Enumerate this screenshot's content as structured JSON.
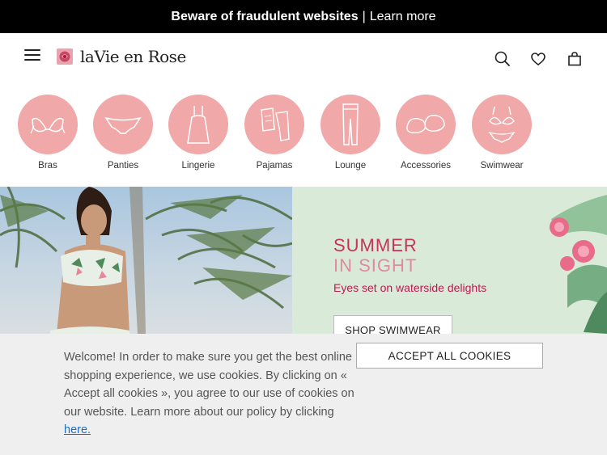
{
  "announcement": {
    "title": "Beware of fraudulent websites",
    "separator": "|",
    "link": "Learn more"
  },
  "header": {
    "logo_text": "laVie en Rose",
    "menu_icon": "hamburger-icon",
    "icons": [
      "search-icon",
      "heart-icon",
      "shopping-bag-icon"
    ]
  },
  "categories": [
    {
      "label": "Bras",
      "icon": "bra-icon"
    },
    {
      "label": "Panties",
      "icon": "panties-icon"
    },
    {
      "label": "Lingerie",
      "icon": "lingerie-icon"
    },
    {
      "label": "Pajamas",
      "icon": "pajamas-icon"
    },
    {
      "label": "Lounge",
      "icon": "lounge-pants-icon"
    },
    {
      "label": "Accessories",
      "icon": "slippers-icon"
    },
    {
      "label": "Swimwear",
      "icon": "bikini-icon"
    }
  ],
  "hero": {
    "headline_line1": "SUMMER",
    "headline_line2": "IN SIGHT",
    "subline": "Eyes set on waterside delights",
    "button": "SHOP SWIMWEAR"
  },
  "cookie_banner": {
    "text": "Welcome! In order to make sure you get the best online shopping experience, we use cookies. By clicking on « Accept all cookies », you agree to our use of cookies on our website. Learn more about our policy by clicking ",
    "link": "here.",
    "accept_button": "ACCEPT ALL COOKIES"
  },
  "colors": {
    "topbar": "#000000",
    "category_circle": "#f0a8a8",
    "hero_right_bg": "#d9ebd8",
    "headline_pink": "#c8325a",
    "subline": "#c0174f",
    "link": "#1a6fbd"
  }
}
